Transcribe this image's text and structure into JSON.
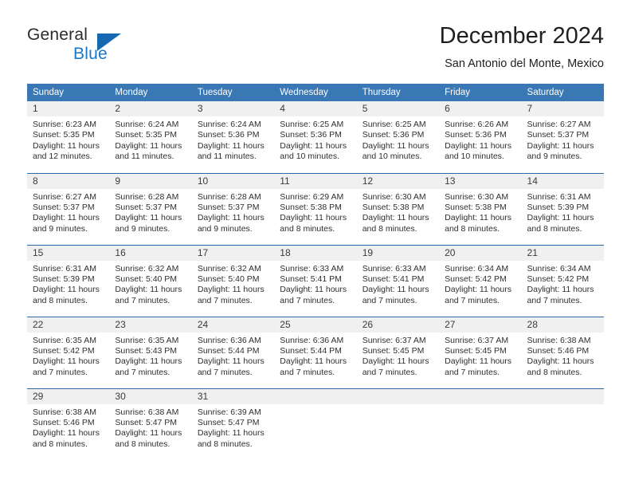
{
  "brand": {
    "name_top": "General",
    "name_bottom": "Blue",
    "accent_color": "#1668b3",
    "text_color": "#2b2b2b"
  },
  "header": {
    "title": "December 2024",
    "subtitle": "San Antonio del Monte, Mexico"
  },
  "calendar": {
    "header_bg": "#3a77b5",
    "daynum_bg": "#f0f0f0",
    "weekday_headers": [
      "Sunday",
      "Monday",
      "Tuesday",
      "Wednesday",
      "Thursday",
      "Friday",
      "Saturday"
    ],
    "weeks": [
      [
        {
          "day": "1",
          "sunrise": "Sunrise: 6:23 AM",
          "sunset": "Sunset: 5:35 PM",
          "daylight_1": "Daylight: 11 hours",
          "daylight_2": "and 12 minutes."
        },
        {
          "day": "2",
          "sunrise": "Sunrise: 6:24 AM",
          "sunset": "Sunset: 5:35 PM",
          "daylight_1": "Daylight: 11 hours",
          "daylight_2": "and 11 minutes."
        },
        {
          "day": "3",
          "sunrise": "Sunrise: 6:24 AM",
          "sunset": "Sunset: 5:36 PM",
          "daylight_1": "Daylight: 11 hours",
          "daylight_2": "and 11 minutes."
        },
        {
          "day": "4",
          "sunrise": "Sunrise: 6:25 AM",
          "sunset": "Sunset: 5:36 PM",
          "daylight_1": "Daylight: 11 hours",
          "daylight_2": "and 10 minutes."
        },
        {
          "day": "5",
          "sunrise": "Sunrise: 6:25 AM",
          "sunset": "Sunset: 5:36 PM",
          "daylight_1": "Daylight: 11 hours",
          "daylight_2": "and 10 minutes."
        },
        {
          "day": "6",
          "sunrise": "Sunrise: 6:26 AM",
          "sunset": "Sunset: 5:36 PM",
          "daylight_1": "Daylight: 11 hours",
          "daylight_2": "and 10 minutes."
        },
        {
          "day": "7",
          "sunrise": "Sunrise: 6:27 AM",
          "sunset": "Sunset: 5:37 PM",
          "daylight_1": "Daylight: 11 hours",
          "daylight_2": "and 9 minutes."
        }
      ],
      [
        {
          "day": "8",
          "sunrise": "Sunrise: 6:27 AM",
          "sunset": "Sunset: 5:37 PM",
          "daylight_1": "Daylight: 11 hours",
          "daylight_2": "and 9 minutes."
        },
        {
          "day": "9",
          "sunrise": "Sunrise: 6:28 AM",
          "sunset": "Sunset: 5:37 PM",
          "daylight_1": "Daylight: 11 hours",
          "daylight_2": "and 9 minutes."
        },
        {
          "day": "10",
          "sunrise": "Sunrise: 6:28 AM",
          "sunset": "Sunset: 5:37 PM",
          "daylight_1": "Daylight: 11 hours",
          "daylight_2": "and 9 minutes."
        },
        {
          "day": "11",
          "sunrise": "Sunrise: 6:29 AM",
          "sunset": "Sunset: 5:38 PM",
          "daylight_1": "Daylight: 11 hours",
          "daylight_2": "and 8 minutes."
        },
        {
          "day": "12",
          "sunrise": "Sunrise: 6:30 AM",
          "sunset": "Sunset: 5:38 PM",
          "daylight_1": "Daylight: 11 hours",
          "daylight_2": "and 8 minutes."
        },
        {
          "day": "13",
          "sunrise": "Sunrise: 6:30 AM",
          "sunset": "Sunset: 5:38 PM",
          "daylight_1": "Daylight: 11 hours",
          "daylight_2": "and 8 minutes."
        },
        {
          "day": "14",
          "sunrise": "Sunrise: 6:31 AM",
          "sunset": "Sunset: 5:39 PM",
          "daylight_1": "Daylight: 11 hours",
          "daylight_2": "and 8 minutes."
        }
      ],
      [
        {
          "day": "15",
          "sunrise": "Sunrise: 6:31 AM",
          "sunset": "Sunset: 5:39 PM",
          "daylight_1": "Daylight: 11 hours",
          "daylight_2": "and 8 minutes."
        },
        {
          "day": "16",
          "sunrise": "Sunrise: 6:32 AM",
          "sunset": "Sunset: 5:40 PM",
          "daylight_1": "Daylight: 11 hours",
          "daylight_2": "and 7 minutes."
        },
        {
          "day": "17",
          "sunrise": "Sunrise: 6:32 AM",
          "sunset": "Sunset: 5:40 PM",
          "daylight_1": "Daylight: 11 hours",
          "daylight_2": "and 7 minutes."
        },
        {
          "day": "18",
          "sunrise": "Sunrise: 6:33 AM",
          "sunset": "Sunset: 5:41 PM",
          "daylight_1": "Daylight: 11 hours",
          "daylight_2": "and 7 minutes."
        },
        {
          "day": "19",
          "sunrise": "Sunrise: 6:33 AM",
          "sunset": "Sunset: 5:41 PM",
          "daylight_1": "Daylight: 11 hours",
          "daylight_2": "and 7 minutes."
        },
        {
          "day": "20",
          "sunrise": "Sunrise: 6:34 AM",
          "sunset": "Sunset: 5:42 PM",
          "daylight_1": "Daylight: 11 hours",
          "daylight_2": "and 7 minutes."
        },
        {
          "day": "21",
          "sunrise": "Sunrise: 6:34 AM",
          "sunset": "Sunset: 5:42 PM",
          "daylight_1": "Daylight: 11 hours",
          "daylight_2": "and 7 minutes."
        }
      ],
      [
        {
          "day": "22",
          "sunrise": "Sunrise: 6:35 AM",
          "sunset": "Sunset: 5:42 PM",
          "daylight_1": "Daylight: 11 hours",
          "daylight_2": "and 7 minutes."
        },
        {
          "day": "23",
          "sunrise": "Sunrise: 6:35 AM",
          "sunset": "Sunset: 5:43 PM",
          "daylight_1": "Daylight: 11 hours",
          "daylight_2": "and 7 minutes."
        },
        {
          "day": "24",
          "sunrise": "Sunrise: 6:36 AM",
          "sunset": "Sunset: 5:44 PM",
          "daylight_1": "Daylight: 11 hours",
          "daylight_2": "and 7 minutes."
        },
        {
          "day": "25",
          "sunrise": "Sunrise: 6:36 AM",
          "sunset": "Sunset: 5:44 PM",
          "daylight_1": "Daylight: 11 hours",
          "daylight_2": "and 7 minutes."
        },
        {
          "day": "26",
          "sunrise": "Sunrise: 6:37 AM",
          "sunset": "Sunset: 5:45 PM",
          "daylight_1": "Daylight: 11 hours",
          "daylight_2": "and 7 minutes."
        },
        {
          "day": "27",
          "sunrise": "Sunrise: 6:37 AM",
          "sunset": "Sunset: 5:45 PM",
          "daylight_1": "Daylight: 11 hours",
          "daylight_2": "and 7 minutes."
        },
        {
          "day": "28",
          "sunrise": "Sunrise: 6:38 AM",
          "sunset": "Sunset: 5:46 PM",
          "daylight_1": "Daylight: 11 hours",
          "daylight_2": "and 8 minutes."
        }
      ],
      [
        {
          "day": "29",
          "sunrise": "Sunrise: 6:38 AM",
          "sunset": "Sunset: 5:46 PM",
          "daylight_1": "Daylight: 11 hours",
          "daylight_2": "and 8 minutes."
        },
        {
          "day": "30",
          "sunrise": "Sunrise: 6:38 AM",
          "sunset": "Sunset: 5:47 PM",
          "daylight_1": "Daylight: 11 hours",
          "daylight_2": "and 8 minutes."
        },
        {
          "day": "31",
          "sunrise": "Sunrise: 6:39 AM",
          "sunset": "Sunset: 5:47 PM",
          "daylight_1": "Daylight: 11 hours",
          "daylight_2": "and 8 minutes."
        },
        {
          "day": "",
          "sunrise": "",
          "sunset": "",
          "daylight_1": "",
          "daylight_2": ""
        },
        {
          "day": "",
          "sunrise": "",
          "sunset": "",
          "daylight_1": "",
          "daylight_2": ""
        },
        {
          "day": "",
          "sunrise": "",
          "sunset": "",
          "daylight_1": "",
          "daylight_2": ""
        },
        {
          "day": "",
          "sunrise": "",
          "sunset": "",
          "daylight_1": "",
          "daylight_2": ""
        }
      ]
    ]
  }
}
